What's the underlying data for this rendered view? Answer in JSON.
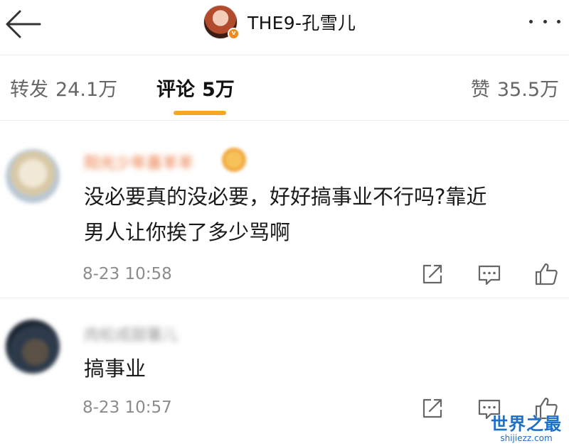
{
  "header": {
    "username": "THE9-孔雪儿",
    "verified_badge": "v"
  },
  "tabs": {
    "repost": {
      "label": "转发",
      "count": "24.1万"
    },
    "comment": {
      "label": "评论",
      "count": "5万"
    },
    "like": {
      "label": "赞",
      "count": "35.5万"
    }
  },
  "comments": [
    {
      "username": "阳光少年喜羊羊",
      "text_line1": "没必要真的没必要，好好搞事业不行吗?靠近",
      "text_line2": "男人让你挨了多少骂啊",
      "time": "8-23 10:58"
    },
    {
      "username": "肉松成甜薯儿",
      "text_line1": "搞事业",
      "time": "8-23 10:57"
    }
  ],
  "watermark": {
    "title": "世界之最",
    "url": "shijiezz.com"
  },
  "colors": {
    "accent": "#f5a623",
    "username_highlight": "#e8692b",
    "muted_text": "#8c8c8c",
    "watermark": "#1d6fc9"
  },
  "icons": [
    "back-arrow-icon",
    "more-dots-icon",
    "share-icon",
    "reply-icon",
    "thumb-up-icon"
  ]
}
